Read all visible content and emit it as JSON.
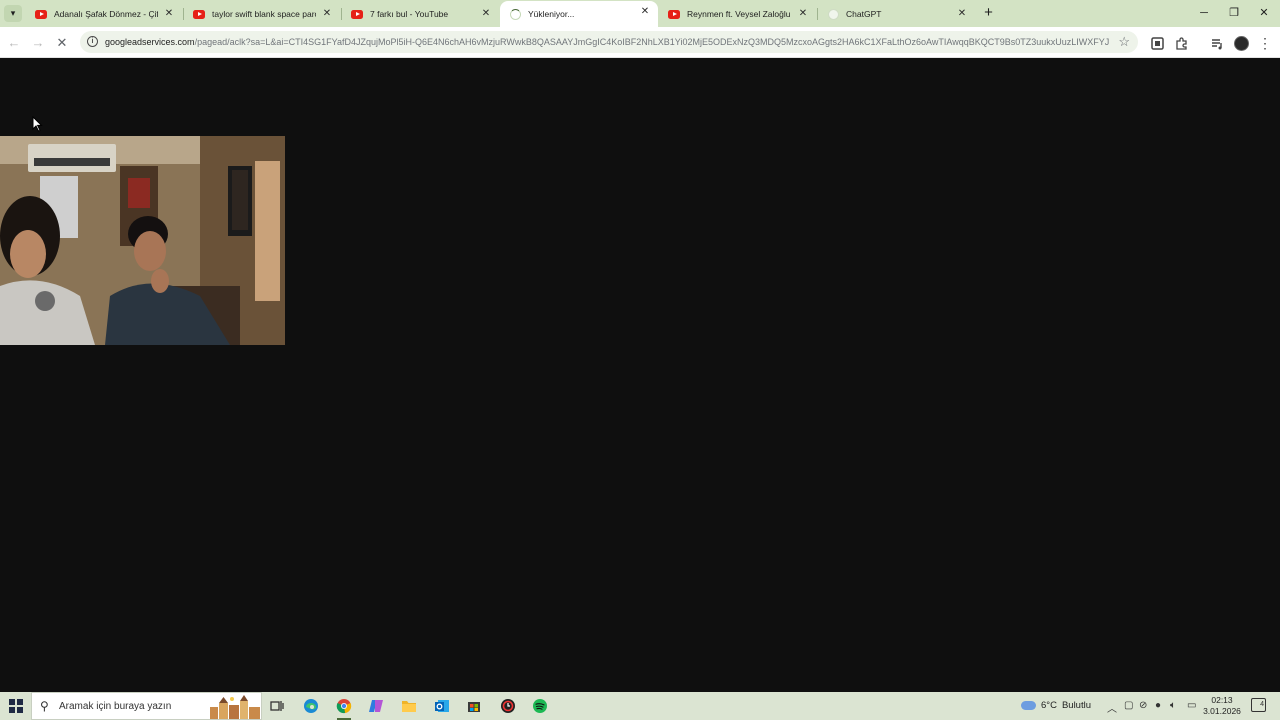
{
  "browser": {
    "tabs": [
      {
        "title": "Adanalı Şafak Dönmez - Çiftetelli",
        "favicon": "youtube-icon",
        "active": false
      },
      {
        "title": "taylor swift blank space parodi",
        "favicon": "youtube-icon",
        "active": false
      },
      {
        "title": "7 farkı bul - YouTube",
        "favicon": "youtube-icon",
        "active": false
      },
      {
        "title": "Yükleniyor...",
        "favicon": "loading-spinner-icon",
        "active": true
      },
      {
        "title": "Reynmen ft. Veysel Zaloğlu - Veda",
        "favicon": "youtube-icon",
        "active": false
      },
      {
        "title": "ChatGPT",
        "favicon": "chatgpt-icon",
        "active": false
      }
    ],
    "url": {
      "domain": "googleadservices.com",
      "path": "/pagead/aclk?sa=L&ai=CTI4SG1FYafD4JZqujMoPl5iH-Q6E4N6chAH6vMzjuRWwkB8QASAAYJmGgIC4KoIBF2NhLXB1Yi02MjE5ODExNzQ3MDQ5MzcxoAGgts2HA6kC1XFaLthOz6oAwTIAwqqBKQCT9Bs0TZ3uukxUuzLIWXFYJ..."
    }
  },
  "taskbar": {
    "search_placeholder": "Aramak için buraya yazın",
    "weather_temp": "6°C",
    "weather_desc": "Bulutlu",
    "time": "02:13",
    "date": "3.01.2026",
    "notification_count": "4"
  },
  "colors": {
    "page_background": "#0f0f0f",
    "tabstrip": "#d3e3c4",
    "taskbar": "#dbe4d2",
    "youtube_red": "#e62117",
    "spotify_green": "#1db954"
  }
}
